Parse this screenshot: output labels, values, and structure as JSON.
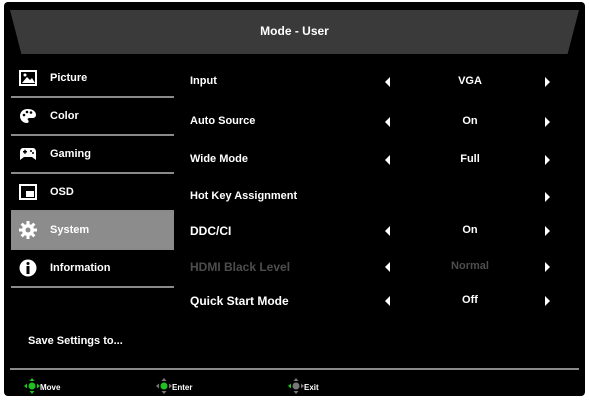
{
  "header": {
    "title": "Mode - User"
  },
  "sidebar": {
    "items": [
      {
        "label": "Picture",
        "icon": "picture-icon"
      },
      {
        "label": "Color",
        "icon": "palette-icon"
      },
      {
        "label": "Gaming",
        "icon": "gamepad-icon"
      },
      {
        "label": "OSD",
        "icon": "osd-window-icon"
      },
      {
        "label": "System",
        "icon": "gear-icon",
        "selected": true
      },
      {
        "label": "Information",
        "icon": "info-icon"
      }
    ],
    "save_label": "Save Settings to..."
  },
  "settings": [
    {
      "name": "Input",
      "value": "VGA"
    },
    {
      "name": "Auto Source",
      "value": "On"
    },
    {
      "name": "Wide Mode",
      "value": "Full"
    },
    {
      "name": "Hot Key Assignment",
      "value": ""
    },
    {
      "name": "DDC/CI",
      "value": "On"
    },
    {
      "name": "HDMI Black Level",
      "value": "Normal",
      "disabled": true
    },
    {
      "name": "Quick Start Mode",
      "value": "Off"
    }
  ],
  "footer": {
    "move": "Move",
    "enter": "Enter",
    "exit": "Exit"
  },
  "colors": {
    "background": "#000000",
    "header": "#3a3a3a",
    "selected": "#8c8c8c",
    "accent_green": "#1fc01f",
    "disabled_text": "#4d4d4d"
  }
}
